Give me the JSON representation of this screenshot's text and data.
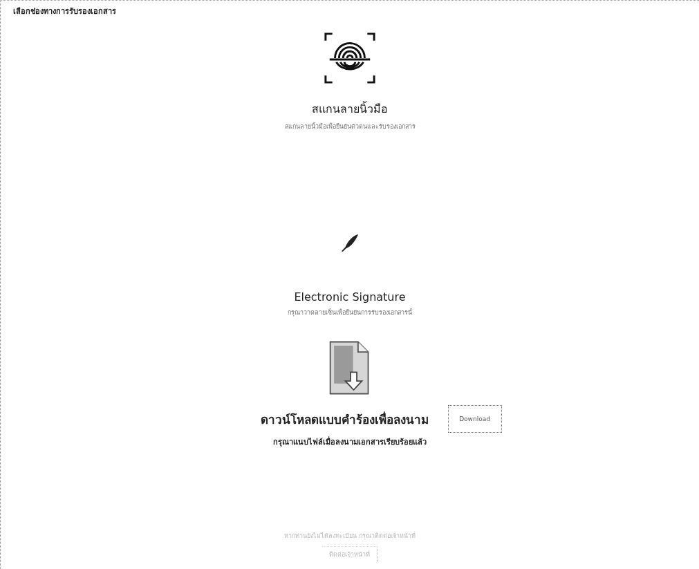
{
  "title": "เลือกช่องทางการรับรองเอกสาร",
  "options": [
    {
      "kind": "fingerprint",
      "heading": "สแกนลายนิ้วมือ",
      "description": "สแกนลายนิ้วมือเพื่อยืนยันตัวตนและรับรองเอกสาร"
    },
    {
      "kind": "signature",
      "heading": "Electronic Signature",
      "description": "กรุณาวาดลายเซ็นเพื่อยืนยันการรับรองเอกสารนี้"
    },
    {
      "kind": "download",
      "heading": "ดาวน์โหลดแบบคำร้องเพื่อลงนาม",
      "button": "Download",
      "description": "กรุณาแนบไฟล์เมื่อลงนามเอกสารเรียบร้อยแล้ว"
    }
  ],
  "footer": {
    "note": "หากท่านยังไม่ได้ลงทะเบียน กรุณาติดต่อเจ้าหน้าที่",
    "button": "ติดต่อเจ้าหน้าที่"
  }
}
